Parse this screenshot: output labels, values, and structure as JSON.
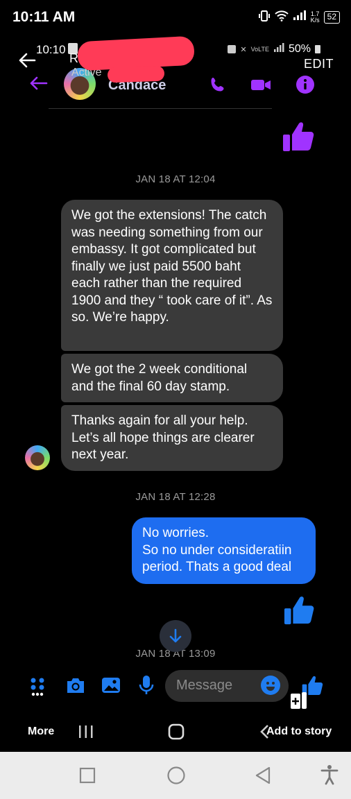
{
  "status_bar": {
    "time": "10:11 AM",
    "speed_value": "1.7",
    "speed_unit": "K/s",
    "battery": "52"
  },
  "inner_status": {
    "time": "10:10",
    "battery": "50%",
    "edit_label": "EDIT",
    "active_partial": "Active",
    "title_initial": "R"
  },
  "header": {
    "contact_name": "Candace"
  },
  "colors": {
    "messenger_purple": "#a033ff",
    "outgoing_blue": "#1e6df0",
    "thumb_blue": "#1f7cf0",
    "redaction_red": "#ff3b57"
  },
  "messages": [
    {
      "type": "timestamp",
      "text": "JAN 18 AT 12:04"
    },
    {
      "type": "incoming",
      "text": "We got the extensions! The catch was needing something from our embassy.  It got complicated but finally we just paid 5500 baht each rather than the required 1900 and they “ took care of it”.  As so. We’re happy."
    },
    {
      "type": "incoming",
      "text": "We got the 2 week conditional and the final 60 day stamp."
    },
    {
      "type": "incoming",
      "text": "Thanks again for all your help. Let’s all hope things are clearer next year."
    },
    {
      "type": "timestamp",
      "text": "JAN 18 AT 12:28"
    },
    {
      "type": "outgoing",
      "text": "No worries.\nSo no under consideratiin period. Thats a good deal"
    },
    {
      "type": "timestamp",
      "text": "JAN 18 AT 13:09"
    }
  ],
  "composer": {
    "placeholder": "Message"
  },
  "inner_nav": {
    "more_label": "More",
    "story_label": "Add to story"
  }
}
